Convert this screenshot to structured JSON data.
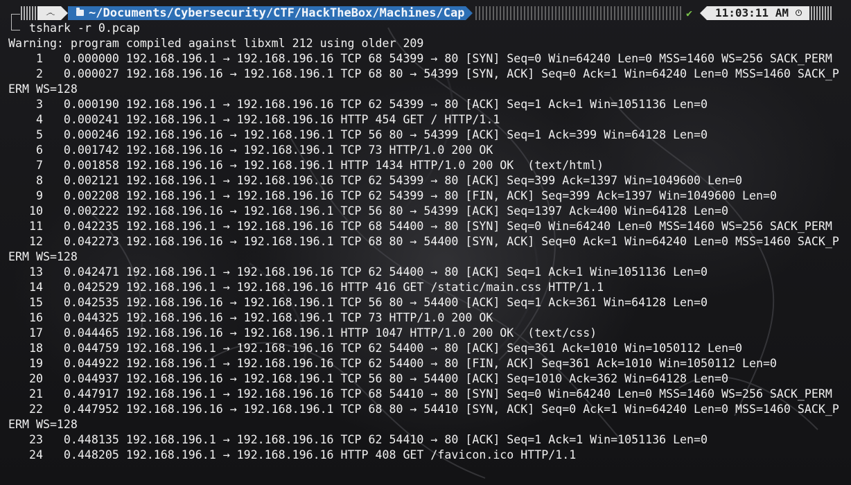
{
  "prompt": {
    "os_icon": "debian-icon",
    "folder_icon": "folder-icon",
    "path": "~/Documents/Cybersecurity/CTF/HackTheBox/Machines/Cap",
    "status_icon": "check-icon",
    "status_mark": "✔",
    "time": "11:03:11 AM",
    "time_icon": "clock-icon"
  },
  "command": "tshark -r 0.pcap",
  "warning": "Warning: program compiled against libxml 212 using older 209",
  "output_lines": [
    "    1   0.000000 192.168.196.1 → 192.168.196.16 TCP 68 54399 → 80 [SYN] Seq=0 Win=64240 Len=0 MSS=1460 WS=256 SACK_PERM",
    "    2   0.000027 192.168.196.16 → 192.168.196.1 TCP 68 80 → 54399 [SYN, ACK] Seq=0 Ack=1 Win=64240 Len=0 MSS=1460 SACK_P",
    "ERM WS=128",
    "    3   0.000190 192.168.196.1 → 192.168.196.16 TCP 62 54399 → 80 [ACK] Seq=1 Ack=1 Win=1051136 Len=0",
    "    4   0.000241 192.168.196.1 → 192.168.196.16 HTTP 454 GET / HTTP/1.1",
    "    5   0.000246 192.168.196.16 → 192.168.196.1 TCP 56 80 → 54399 [ACK] Seq=1 Ack=399 Win=64128 Len=0",
    "    6   0.001742 192.168.196.16 → 192.168.196.1 TCP 73 HTTP/1.0 200 OK",
    "    7   0.001858 192.168.196.16 → 192.168.196.1 HTTP 1434 HTTP/1.0 200 OK  (text/html)",
    "    8   0.002121 192.168.196.1 → 192.168.196.16 TCP 62 54399 → 80 [ACK] Seq=399 Ack=1397 Win=1049600 Len=0",
    "    9   0.002208 192.168.196.1 → 192.168.196.16 TCP 62 54399 → 80 [FIN, ACK] Seq=399 Ack=1397 Win=1049600 Len=0",
    "   10   0.002222 192.168.196.16 → 192.168.196.1 TCP 56 80 → 54399 [ACK] Seq=1397 Ack=400 Win=64128 Len=0",
    "   11   0.042235 192.168.196.1 → 192.168.196.16 TCP 68 54400 → 80 [SYN] Seq=0 Win=64240 Len=0 MSS=1460 WS=256 SACK_PERM",
    "   12   0.042273 192.168.196.16 → 192.168.196.1 TCP 68 80 → 54400 [SYN, ACK] Seq=0 Ack=1 Win=64240 Len=0 MSS=1460 SACK_P",
    "ERM WS=128",
    "   13   0.042471 192.168.196.1 → 192.168.196.16 TCP 62 54400 → 80 [ACK] Seq=1 Ack=1 Win=1051136 Len=0",
    "   14   0.042529 192.168.196.1 → 192.168.196.16 HTTP 416 GET /static/main.css HTTP/1.1",
    "   15   0.042535 192.168.196.16 → 192.168.196.1 TCP 56 80 → 54400 [ACK] Seq=1 Ack=361 Win=64128 Len=0",
    "   16   0.044325 192.168.196.16 → 192.168.196.1 TCP 73 HTTP/1.0 200 OK",
    "   17   0.044465 192.168.196.16 → 192.168.196.1 HTTP 1047 HTTP/1.0 200 OK  (text/css)",
    "   18   0.044759 192.168.196.1 → 192.168.196.16 TCP 62 54400 → 80 [ACK] Seq=361 Ack=1010 Win=1050112 Len=0",
    "   19   0.044922 192.168.196.1 → 192.168.196.16 TCP 62 54400 → 80 [FIN, ACK] Seq=361 Ack=1010 Win=1050112 Len=0",
    "   20   0.044937 192.168.196.16 → 192.168.196.1 TCP 56 80 → 54400 [ACK] Seq=1010 Ack=362 Win=64128 Len=0",
    "   21   0.447917 192.168.196.1 → 192.168.196.16 TCP 68 54410 → 80 [SYN] Seq=0 Win=64240 Len=0 MSS=1460 WS=256 SACK_PERM",
    "   22   0.447952 192.168.196.16 → 192.168.196.1 TCP 68 80 → 54410 [SYN, ACK] Seq=0 Ack=1 Win=64240 Len=0 MSS=1460 SACK_P",
    "ERM WS=128",
    "   23   0.448135 192.168.196.1 → 192.168.196.16 TCP 62 54410 → 80 [ACK] Seq=1 Ack=1 Win=1051136 Len=0",
    "   24   0.448205 192.168.196.1 → 192.168.196.16 HTTP 408 GET /favicon.ico HTTP/1.1"
  ]
}
